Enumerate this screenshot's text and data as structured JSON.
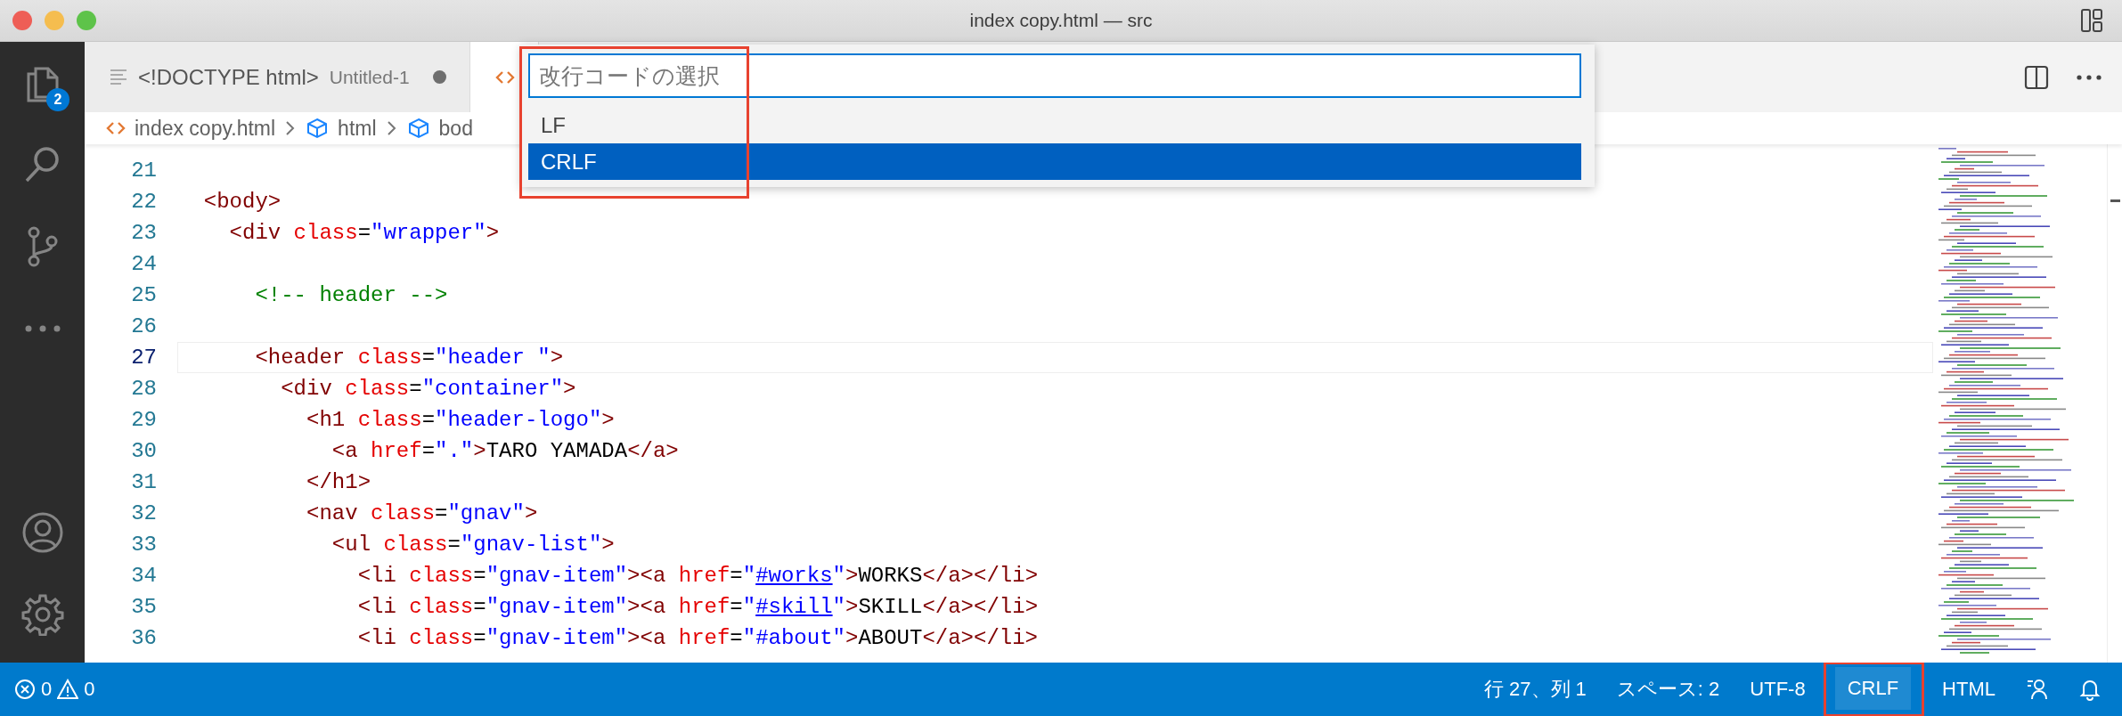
{
  "window": {
    "title": "index copy.html — src"
  },
  "activity_bar": {
    "items": [
      {
        "kind": "explorer",
        "badge": "2"
      },
      {
        "kind": "search"
      },
      {
        "kind": "source-control"
      },
      {
        "kind": "more"
      }
    ],
    "bottom": [
      {
        "kind": "account"
      },
      {
        "kind": "settings"
      }
    ]
  },
  "tabs": [
    {
      "kind": "text",
      "title": "<!DOCTYPE html>",
      "description": "Untitled-1",
      "dirty": true,
      "selected": false
    },
    {
      "kind": "html",
      "selected": true
    }
  ],
  "breadcrumb": [
    {
      "kind": "file",
      "label": "index copy.html"
    },
    {
      "kind": "element",
      "label": "html"
    },
    {
      "kind": "element",
      "label": "bod"
    }
  ],
  "editor": {
    "lines": [
      {
        "number": "21",
        "current": false
      },
      {
        "number": "22",
        "current": false,
        "tokens": [
          {
            "kind": "tag",
            "text": "  <body>"
          }
        ]
      },
      {
        "number": "23",
        "current": false,
        "tokens": [
          {
            "kind": "tag",
            "text": "    <div"
          },
          {
            "kind": "attr",
            "text": " class"
          },
          {
            "kind": "plain",
            "text": "="
          },
          {
            "kind": "value",
            "text": "\"wrapper\""
          },
          {
            "kind": "tag",
            "text": ">"
          }
        ]
      },
      {
        "number": "24",
        "current": false
      },
      {
        "number": "25",
        "current": false,
        "tokens": [
          {
            "kind": "comment",
            "text": "      <!-- header -->"
          }
        ]
      },
      {
        "number": "26",
        "current": false
      },
      {
        "number": "27",
        "current": true,
        "tokens": [
          {
            "kind": "tag",
            "text": "      <header"
          },
          {
            "kind": "attr",
            "text": " class"
          },
          {
            "kind": "plain",
            "text": "="
          },
          {
            "kind": "value",
            "text": "\"header \""
          },
          {
            "kind": "tag",
            "text": ">"
          }
        ]
      },
      {
        "number": "28",
        "current": false,
        "tokens": [
          {
            "kind": "tag",
            "text": "        <div"
          },
          {
            "kind": "attr",
            "text": " class"
          },
          {
            "kind": "plain",
            "text": "="
          },
          {
            "kind": "value",
            "text": "\"container\""
          },
          {
            "kind": "tag",
            "text": ">"
          }
        ]
      },
      {
        "number": "29",
        "current": false,
        "tokens": [
          {
            "kind": "tag",
            "text": "          <h1"
          },
          {
            "kind": "attr",
            "text": " class"
          },
          {
            "kind": "plain",
            "text": "="
          },
          {
            "kind": "value",
            "text": "\"header-logo\""
          },
          {
            "kind": "tag",
            "text": ">"
          }
        ]
      },
      {
        "number": "30",
        "current": false,
        "tokens": [
          {
            "kind": "tag",
            "text": "            <a"
          },
          {
            "kind": "attr",
            "text": " href"
          },
          {
            "kind": "plain",
            "text": "="
          },
          {
            "kind": "value",
            "text": "\".\""
          },
          {
            "kind": "tag",
            "text": ">"
          },
          {
            "kind": "plain",
            "text": "TARO YAMADA"
          },
          {
            "kind": "tag",
            "text": "</a>"
          }
        ]
      },
      {
        "number": "31",
        "current": false,
        "tokens": [
          {
            "kind": "tag",
            "text": "          </h1>"
          }
        ]
      },
      {
        "number": "32",
        "current": false,
        "tokens": [
          {
            "kind": "tag",
            "text": "          <nav"
          },
          {
            "kind": "attr",
            "text": " class"
          },
          {
            "kind": "plain",
            "text": "="
          },
          {
            "kind": "value",
            "text": "\"gnav\""
          },
          {
            "kind": "tag",
            "text": ">"
          }
        ]
      },
      {
        "number": "33",
        "current": false,
        "tokens": [
          {
            "kind": "tag",
            "text": "            <ul"
          },
          {
            "kind": "attr",
            "text": " class"
          },
          {
            "kind": "plain",
            "text": "="
          },
          {
            "kind": "value",
            "text": "\"gnav-list\""
          },
          {
            "kind": "tag",
            "text": ">"
          }
        ]
      },
      {
        "number": "34",
        "current": false,
        "tokens": [
          {
            "kind": "tag",
            "text": "              <li"
          },
          {
            "kind": "attr",
            "text": " class"
          },
          {
            "kind": "plain",
            "text": "="
          },
          {
            "kind": "value",
            "text": "\"gnav-item\""
          },
          {
            "kind": "tag",
            "text": "><a"
          },
          {
            "kind": "attr",
            "text": " href"
          },
          {
            "kind": "plain",
            "text": "="
          },
          {
            "kind": "value",
            "text": "\""
          },
          {
            "kind": "link",
            "text": "#works"
          },
          {
            "kind": "value",
            "text": "\""
          },
          {
            "kind": "tag",
            "text": ">"
          },
          {
            "kind": "plain",
            "text": "WORKS"
          },
          {
            "kind": "tag",
            "text": "</a></li>"
          }
        ]
      },
      {
        "number": "35",
        "current": false,
        "tokens": [
          {
            "kind": "tag",
            "text": "              <li"
          },
          {
            "kind": "attr",
            "text": " class"
          },
          {
            "kind": "plain",
            "text": "="
          },
          {
            "kind": "value",
            "text": "\"gnav-item\""
          },
          {
            "kind": "tag",
            "text": "><a"
          },
          {
            "kind": "attr",
            "text": " href"
          },
          {
            "kind": "plain",
            "text": "="
          },
          {
            "kind": "value",
            "text": "\""
          },
          {
            "kind": "link",
            "text": "#skill"
          },
          {
            "kind": "value",
            "text": "\""
          },
          {
            "kind": "tag",
            "text": ">"
          },
          {
            "kind": "plain",
            "text": "SKILL"
          },
          {
            "kind": "tag",
            "text": "</a></li>"
          }
        ]
      },
      {
        "number": "36",
        "current": false,
        "tokens": [
          {
            "kind": "tag",
            "text": "              <li"
          },
          {
            "kind": "attr",
            "text": " class"
          },
          {
            "kind": "plain",
            "text": "="
          },
          {
            "kind": "value",
            "text": "\"gnav-item\""
          },
          {
            "kind": "tag",
            "text": "><a"
          },
          {
            "kind": "attr",
            "text": " href"
          },
          {
            "kind": "plain",
            "text": "="
          },
          {
            "kind": "value",
            "text": "\"#about\""
          },
          {
            "kind": "tag",
            "text": ">"
          },
          {
            "kind": "plain",
            "text": "ABOUT"
          },
          {
            "kind": "tag",
            "text": "</a></li>"
          }
        ]
      }
    ]
  },
  "quick_pick": {
    "placeholder": "改行コードの選択",
    "highlighted": true,
    "items": [
      {
        "label": "LF",
        "selected": false
      },
      {
        "label": "CRLF",
        "selected": true
      }
    ]
  },
  "status_bar": {
    "errors": "0",
    "warnings": "0",
    "items": [
      {
        "kind": "text",
        "label": "行 27、列 1",
        "selected": false,
        "highlighted": false
      },
      {
        "kind": "text",
        "label": "スペース: 2",
        "selected": false,
        "highlighted": false
      },
      {
        "kind": "text",
        "label": "UTF-8",
        "selected": false,
        "highlighted": false
      },
      {
        "kind": "text",
        "label": "CRLF",
        "selected": true,
        "highlighted": true
      },
      {
        "kind": "text",
        "label": "HTML",
        "selected": false,
        "highlighted": false
      },
      {
        "kind": "feedback",
        "selected": false,
        "highlighted": false
      },
      {
        "kind": "bell",
        "selected": false,
        "highlighted": false
      }
    ]
  }
}
